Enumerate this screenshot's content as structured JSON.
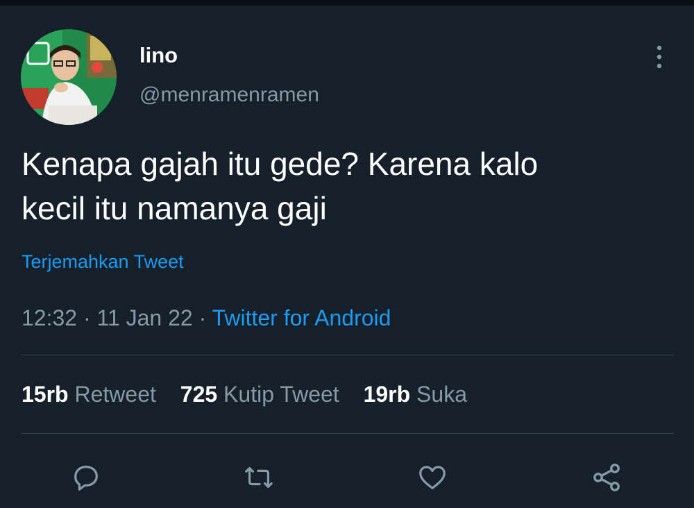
{
  "tweet": {
    "author": {
      "name": "lino",
      "handle": "@menramenramen"
    },
    "text_line1": "Kenapa gajah itu gede? Karena kalo",
    "text_line2": "kecil itu namanya gaji",
    "translate_label": "Terjemahkan Tweet",
    "time": "12:32",
    "date": "11 Jan 22",
    "source": "Twitter for Android",
    "stats": [
      {
        "count": "15rb",
        "label": "Retweet"
      },
      {
        "count": "725",
        "label": "Kutip Tweet"
      },
      {
        "count": "19rb",
        "label": "Suka"
      }
    ],
    "actions": [
      {
        "icon": "reply-icon"
      },
      {
        "icon": "retweet-icon"
      },
      {
        "icon": "like-icon"
      },
      {
        "icon": "share-icon"
      }
    ]
  },
  "colors": {
    "background": "#15202b",
    "text": "#ffffff",
    "secondary_text": "#8899a6",
    "link": "#1d9bf0",
    "divider": "#38444d"
  }
}
